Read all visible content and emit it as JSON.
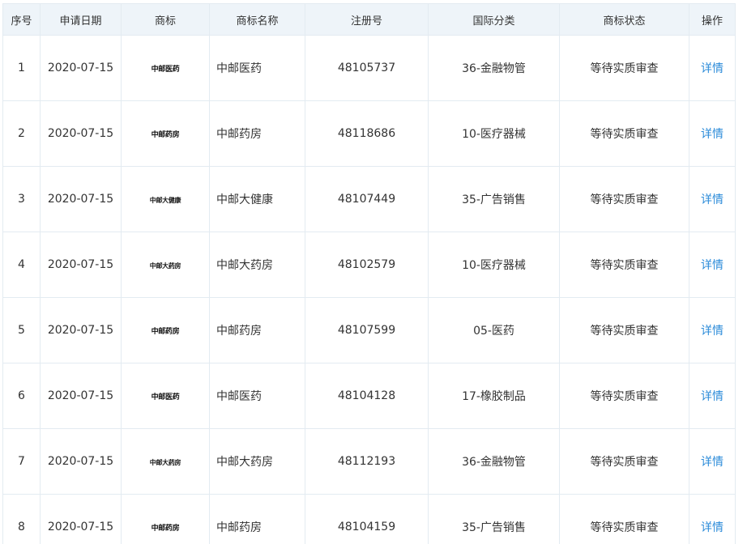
{
  "table": {
    "headers": {
      "index": "序号",
      "date": "申请日期",
      "logo": "商标",
      "name": "商标名称",
      "reg_no": "注册号",
      "class": "国际分类",
      "status": "商标状态",
      "action": "操作"
    },
    "rows": [
      {
        "index": "1",
        "date": "2020-07-15",
        "logo_text": "中邮医药",
        "name": "中邮医药",
        "reg_no": "48105737",
        "class": "36-金融物管",
        "status": "等待实质审查",
        "action": "详情"
      },
      {
        "index": "2",
        "date": "2020-07-15",
        "logo_text": "中邮药房",
        "name": "中邮药房",
        "reg_no": "48118686",
        "class": "10-医疗器械",
        "status": "等待实质审查",
        "action": "详情"
      },
      {
        "index": "3",
        "date": "2020-07-15",
        "logo_text": "中邮大健康",
        "name": "中邮大健康",
        "reg_no": "48107449",
        "class": "35-广告销售",
        "status": "等待实质审查",
        "action": "详情"
      },
      {
        "index": "4",
        "date": "2020-07-15",
        "logo_text": "中邮大药房",
        "name": "中邮大药房",
        "reg_no": "48102579",
        "class": "10-医疗器械",
        "status": "等待实质审查",
        "action": "详情"
      },
      {
        "index": "5",
        "date": "2020-07-15",
        "logo_text": "中邮药房",
        "name": "中邮药房",
        "reg_no": "48107599",
        "class": "05-医药",
        "status": "等待实质审查",
        "action": "详情"
      },
      {
        "index": "6",
        "date": "2020-07-15",
        "logo_text": "中邮医药",
        "name": "中邮医药",
        "reg_no": "48104128",
        "class": "17-橡胶制品",
        "status": "等待实质审查",
        "action": "详情"
      },
      {
        "index": "7",
        "date": "2020-07-15",
        "logo_text": "中邮大药房",
        "name": "中邮大药房",
        "reg_no": "48112193",
        "class": "36-金融物管",
        "status": "等待实质审查",
        "action": "详情"
      },
      {
        "index": "8",
        "date": "2020-07-15",
        "logo_text": "中邮药房",
        "name": "中邮药房",
        "reg_no": "48104159",
        "class": "35-广告销售",
        "status": "等待实质审查",
        "action": "详情"
      }
    ]
  },
  "colors": {
    "header_bg": "#eef4f9",
    "border": "#e3ebf1",
    "link": "#2b8bd9",
    "text": "#333333"
  }
}
